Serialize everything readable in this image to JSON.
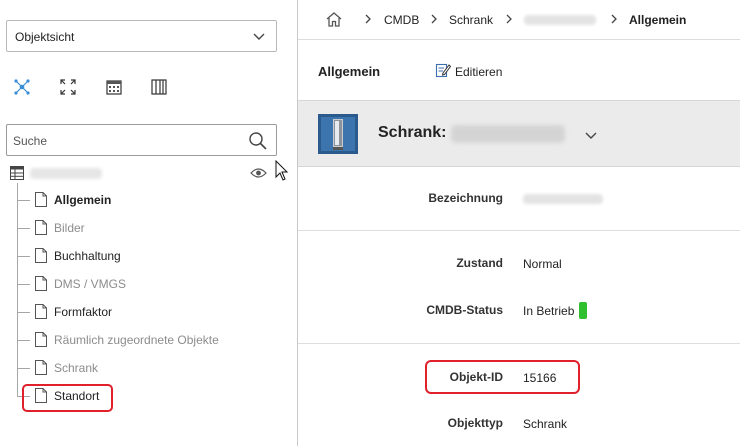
{
  "sidebar": {
    "view_select": {
      "value": "Objektsicht"
    },
    "toolbar": {
      "icons": [
        "graph-icon",
        "expand-icon",
        "calendar-icon",
        "book-icon"
      ]
    },
    "search": {
      "placeholder": "Suche"
    },
    "tree": {
      "nodes": [
        {
          "label": "Allgemein",
          "style": "bold"
        },
        {
          "label": "Bilder",
          "style": "muted"
        },
        {
          "label": "Buchhaltung",
          "style": "dark"
        },
        {
          "label": "DMS / VMGS",
          "style": "muted"
        },
        {
          "label": "Formfaktor",
          "style": "dark"
        },
        {
          "label": "Räumlich zugeordnete Objekte",
          "style": "muted"
        },
        {
          "label": "Schrank",
          "style": "muted"
        },
        {
          "label": "Standort",
          "style": "dark"
        }
      ]
    }
  },
  "breadcrumb": {
    "items": [
      "CMDB",
      "Schrank"
    ],
    "current": "Allgemein"
  },
  "header": {
    "title": "Allgemein",
    "edit_label": "Editieren"
  },
  "object": {
    "label": "Schrank:"
  },
  "fields": {
    "bezeichnung": {
      "key": "Bezeichnung"
    },
    "zustand": {
      "key": "Zustand",
      "value": "Normal"
    },
    "cmdb_status": {
      "key": "CMDB-Status",
      "value": "In Betrieb",
      "color": "#2fbf2f"
    },
    "objekt_id": {
      "key": "Objekt-ID",
      "value": "15166"
    },
    "objekttyp": {
      "key": "Objekttyp",
      "value": "Schrank"
    }
  },
  "colors": {
    "highlight": "#e0202a",
    "icon_blue": "#3b8fd6"
  }
}
